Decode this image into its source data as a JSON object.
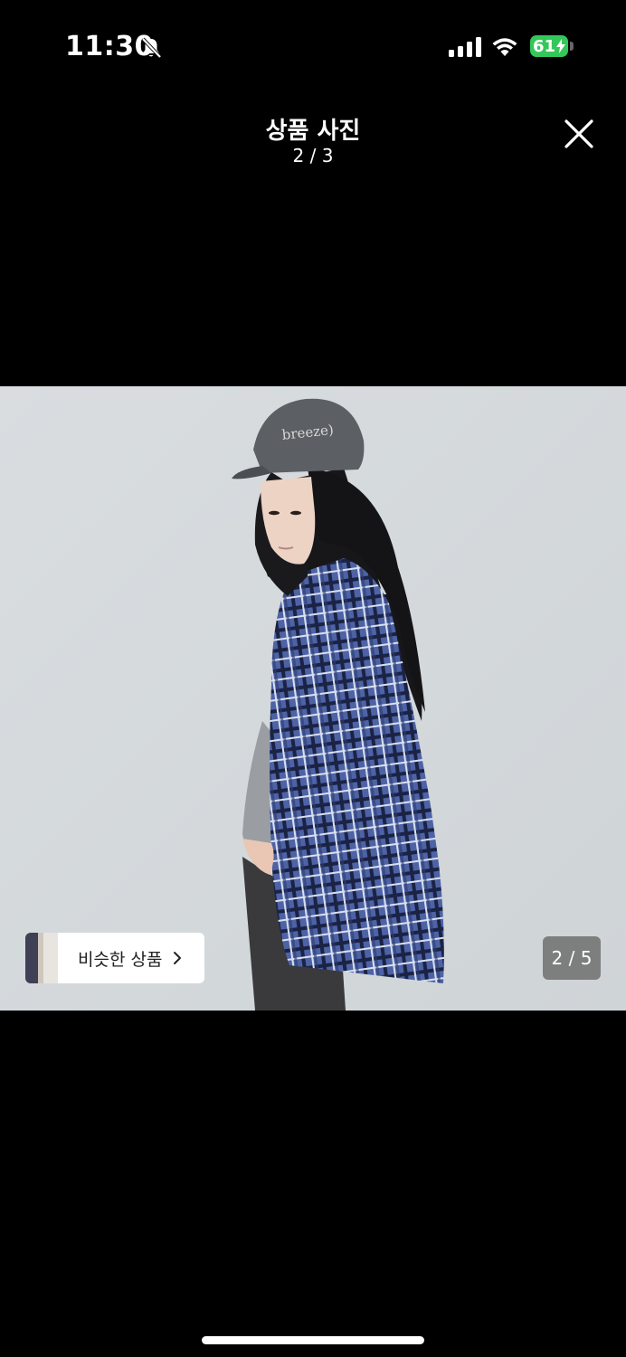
{
  "status_bar": {
    "time": "11:30",
    "battery_level": "61",
    "battery_color": "#34c759",
    "icons": [
      "bell-slash-icon",
      "signal-icon",
      "wifi-icon",
      "battery-charging-icon"
    ]
  },
  "header": {
    "title": "상품 사진",
    "counter": "2 / 3",
    "close_icon": "close-icon"
  },
  "photo": {
    "cap_text": "breeze)",
    "page_indicator": "2 / 5",
    "background_color": "#d6dadc",
    "shirt_color": "#4a5d9a"
  },
  "similar_items": {
    "label": "비슷한 상품",
    "chevron_icon": "chevron-right-icon"
  }
}
